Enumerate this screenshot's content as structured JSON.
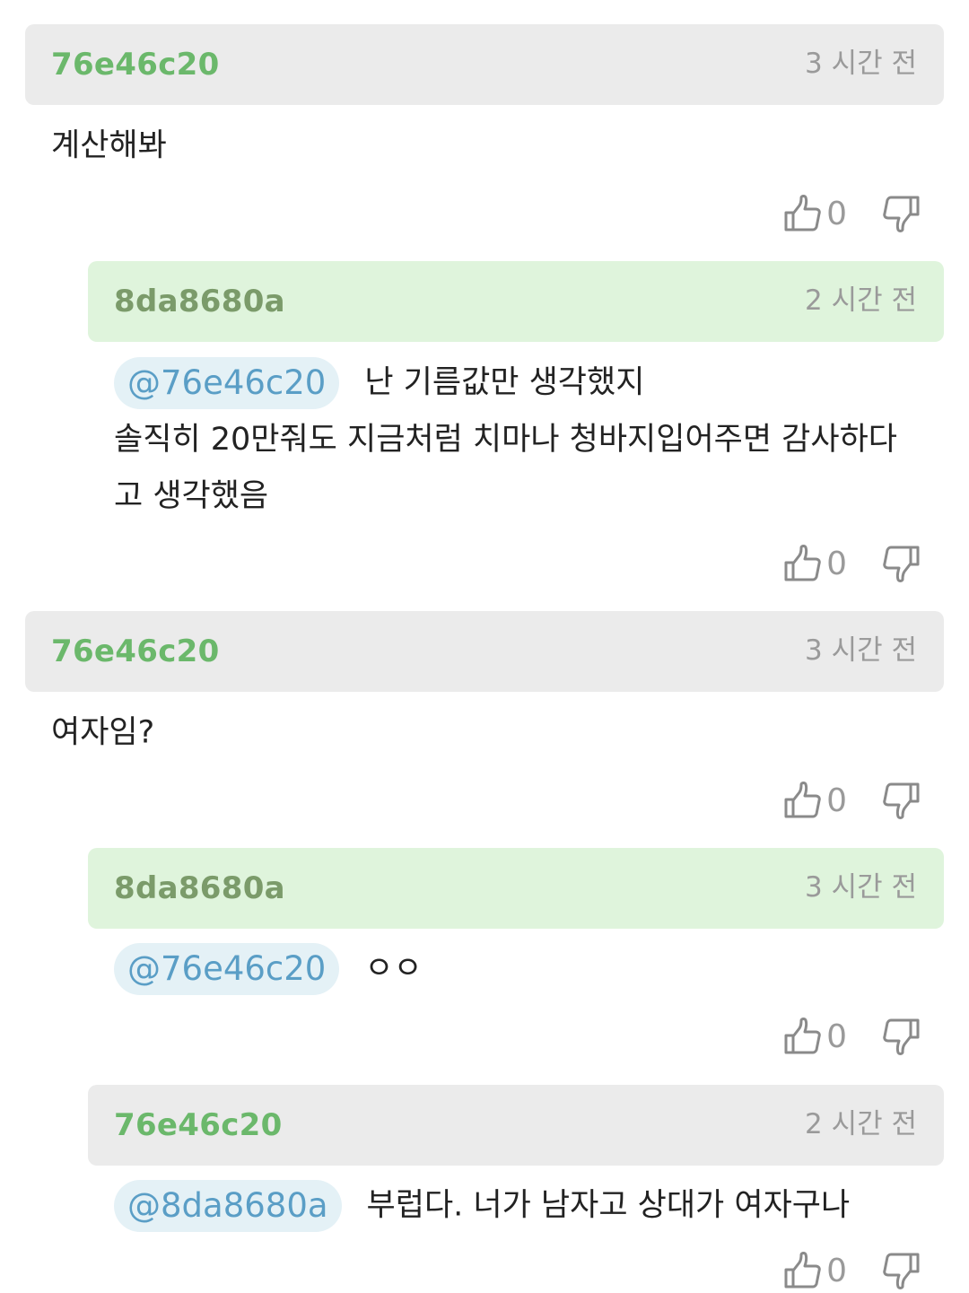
{
  "comments": [
    {
      "author": "76e46c20",
      "time": "3 시간 전",
      "text": "계산해봐",
      "likes": "0"
    },
    {
      "author": "8da8680a",
      "time": "2 시간 전",
      "mention": "@76e46c20",
      "text": "난 기름값만 생각했지",
      "text_line2": "솔직히 20만줘도 지금처럼 치마나 청바지입어주면 감사하다",
      "text_line3": "고 생각했음",
      "likes": "0"
    },
    {
      "author": "76e46c20",
      "time": "3 시간 전",
      "text": "여자임?",
      "likes": "0"
    },
    {
      "author": "8da8680a",
      "time": "3 시간 전",
      "mention": "@76e46c20",
      "text": "ㅇㅇ",
      "likes": "0"
    },
    {
      "author": "76e46c20",
      "time": "2 시간 전",
      "mention": "@8da8680a",
      "text": "부럽다. 너가 남자고 상대가 여자구나",
      "likes": "0"
    }
  ],
  "icons": {
    "like": "thumbs-up-icon",
    "dislike": "thumbs-down-icon"
  },
  "colors": {
    "author_header_bg": "#ebebeb",
    "reply_header_bg": "#dff4dc",
    "author_name": "#6bb86b",
    "reply_name": "#7b9b6a",
    "mention_bg": "#e4f1f6",
    "mention_text": "#5a9ec6"
  }
}
